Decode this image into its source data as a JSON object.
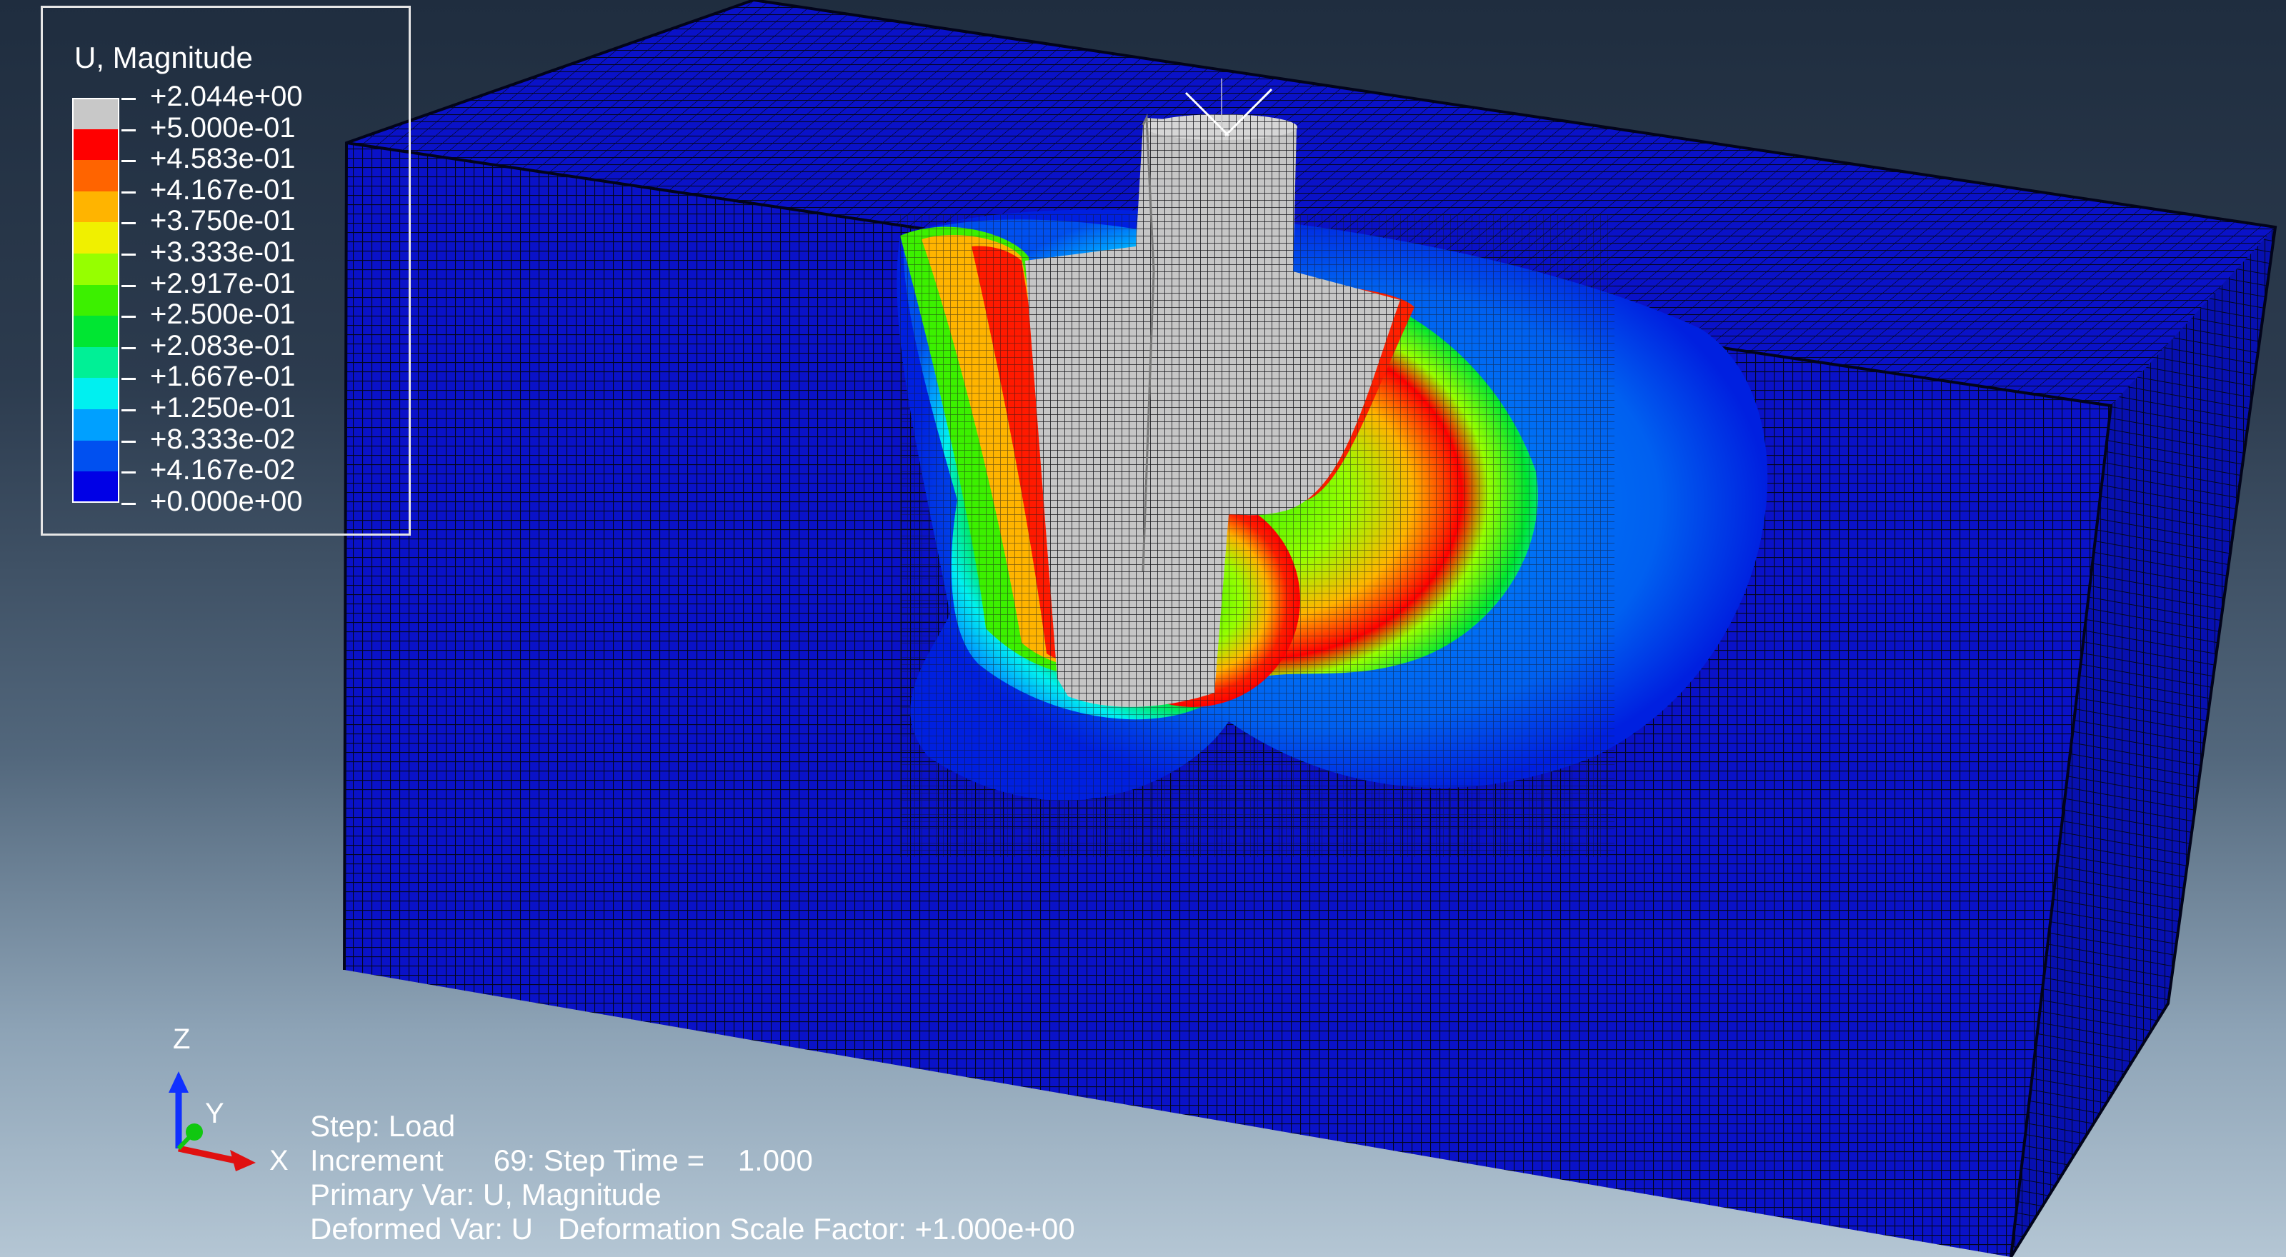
{
  "legend": {
    "title": "U, Magnitude",
    "entries": [
      {
        "value": "+2.044e+00",
        "color": "#c8c8c8"
      },
      {
        "value": "+5.000e-01",
        "color": "#ff0000"
      },
      {
        "value": "+4.583e-01",
        "color": "#ff6400"
      },
      {
        "value": "+4.167e-01",
        "color": "#ffb400"
      },
      {
        "value": "+3.750e-01",
        "color": "#f0f000"
      },
      {
        "value": "+3.333e-01",
        "color": "#96ff00"
      },
      {
        "value": "+2.917e-01",
        "color": "#3cf000"
      },
      {
        "value": "+2.500e-01",
        "color": "#00e632"
      },
      {
        "value": "+2.083e-01",
        "color": "#00f096"
      },
      {
        "value": "+1.667e-01",
        "color": "#00f0f0"
      },
      {
        "value": "+1.250e-01",
        "color": "#00a0ff"
      },
      {
        "value": "+8.333e-02",
        "color": "#0050f0"
      },
      {
        "value": "+4.167e-02",
        "color": "#0000e6"
      },
      {
        "value": "+0.000e+00",
        "color": null
      }
    ]
  },
  "info": {
    "step": "Step: Load",
    "increment": "Increment      69: Step Time =    1.000",
    "primary_var": "Primary Var: U, Magnitude",
    "deformed_var": "Deformed Var: U   Deformation Scale Factor: +1.000e+00"
  },
  "triad": {
    "z_label": "Z",
    "y_label": "Y",
    "x_label": "X"
  },
  "colors": {
    "background_top": "#1f2d3f",
    "background_bottom": "#b4c6d4",
    "mesh_blue": "#0a12c8",
    "mesh_line": "#03061e",
    "pile_gray": "#c6c6c6"
  }
}
